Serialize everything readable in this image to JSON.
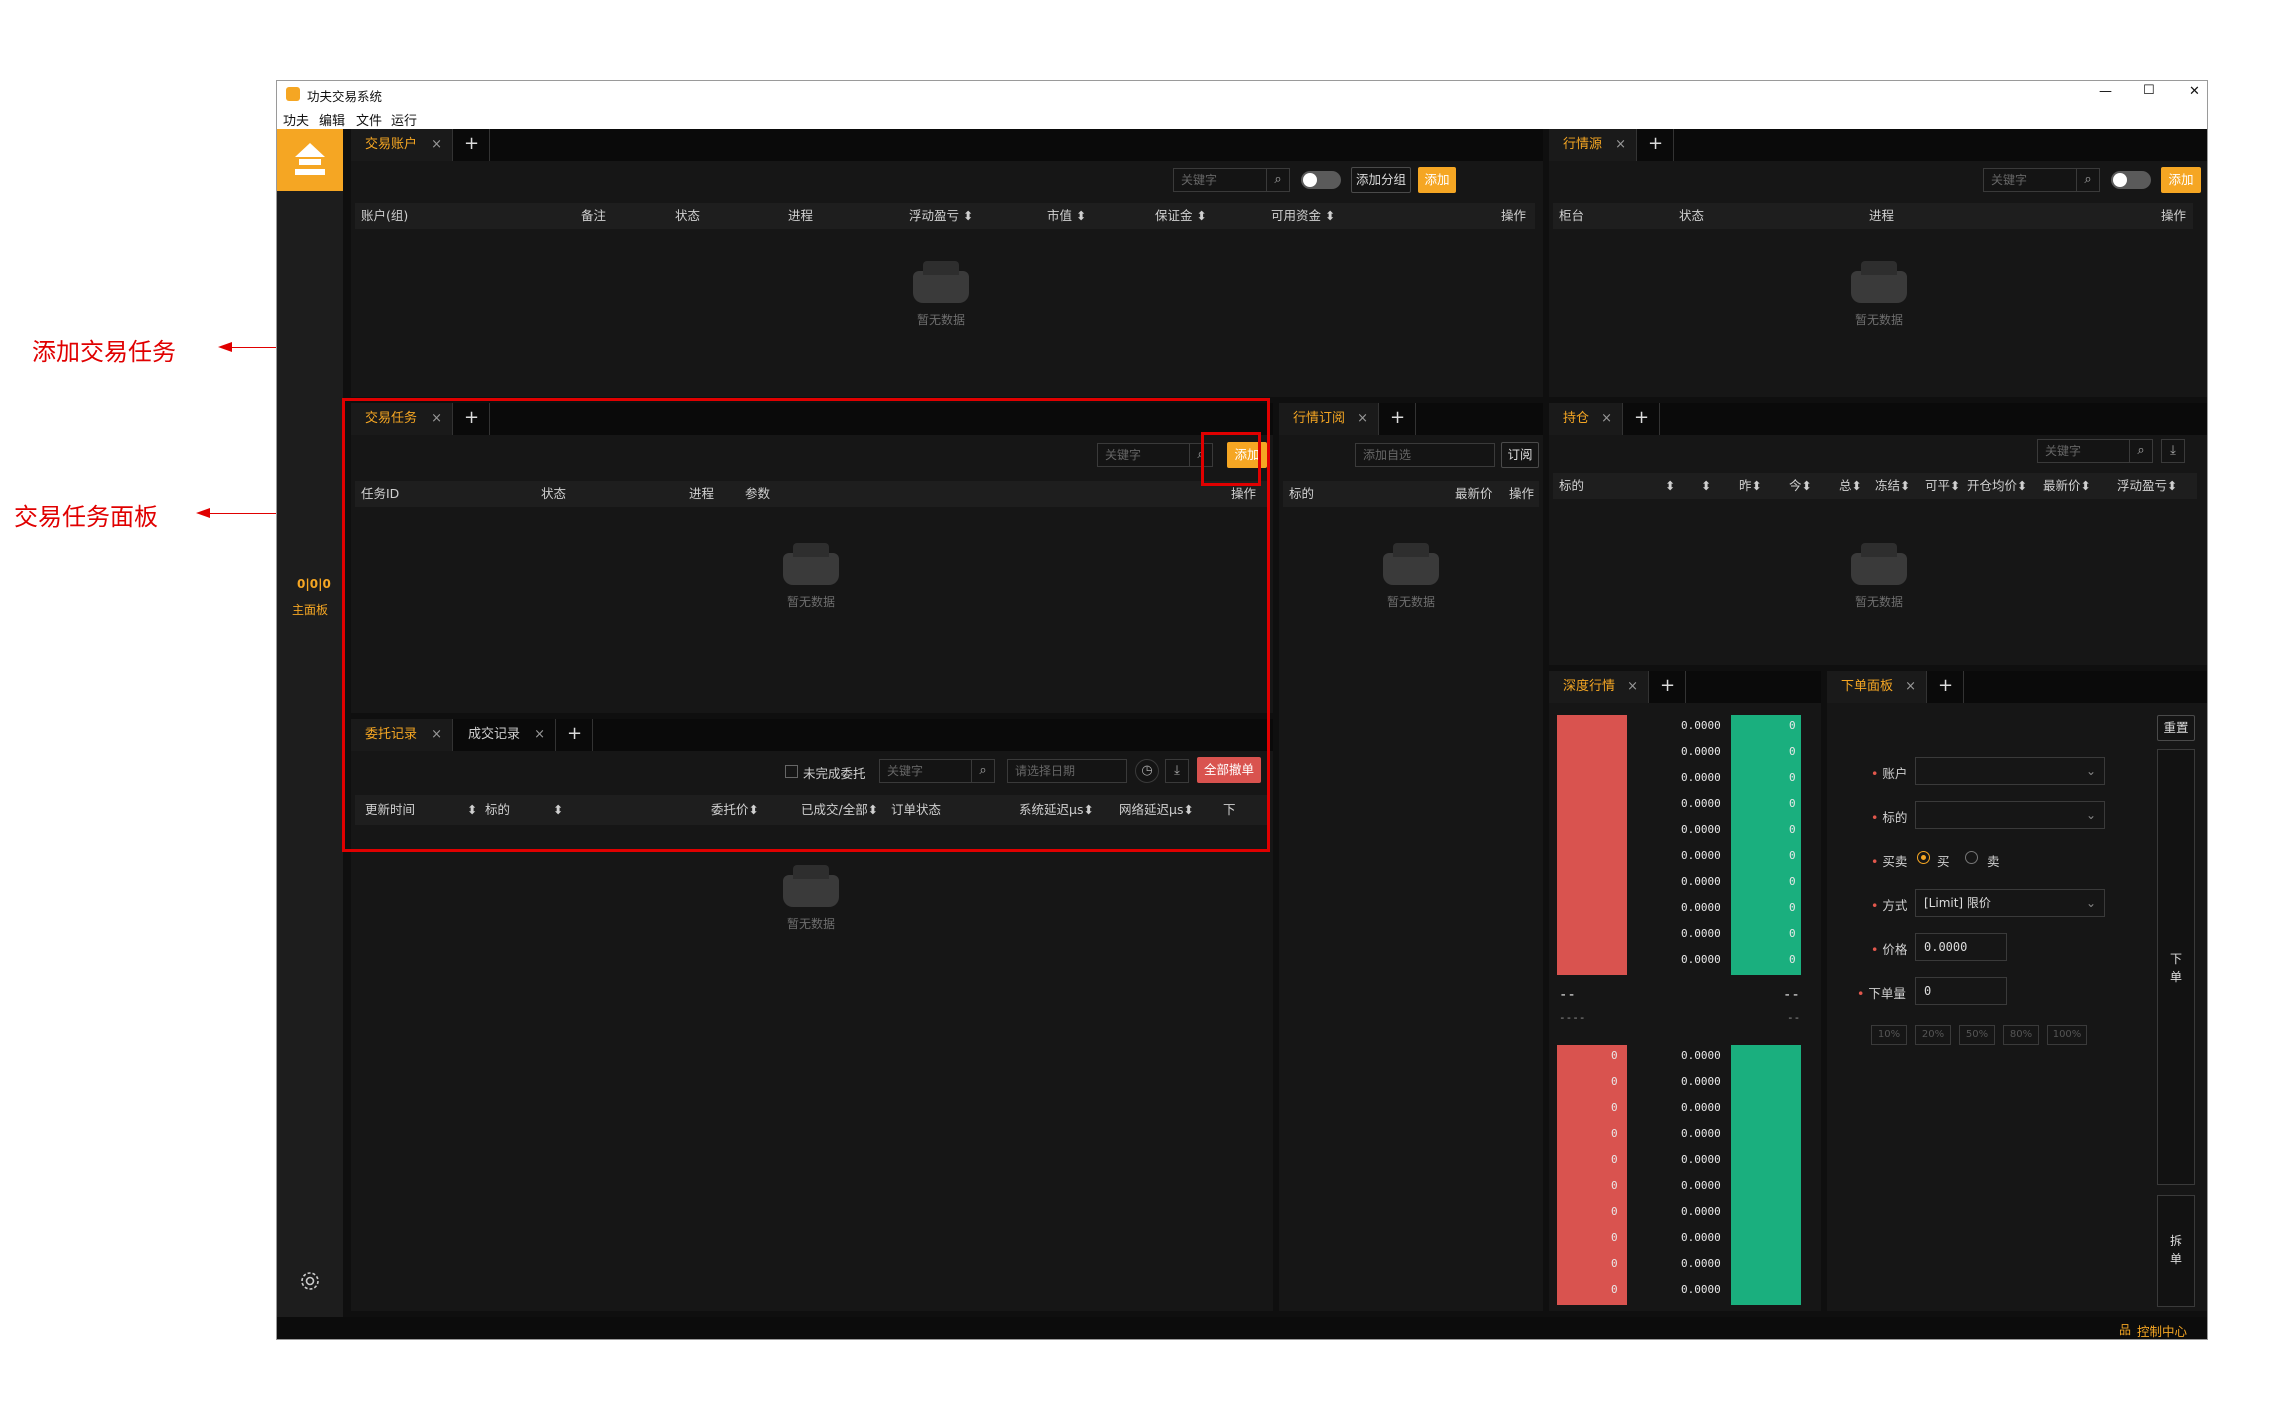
{
  "window": {
    "title": "功夫交易系统",
    "min": "—",
    "max": "☐",
    "close": "✕"
  },
  "menu": [
    "功夫",
    "编辑",
    "文件",
    "运行"
  ],
  "sidebar": {
    "main_label": "主面板",
    "main_icon": "0|0|0"
  },
  "status": {
    "control_center": "控制中心",
    "icon": "品"
  },
  "common": {
    "keyword_ph": "关键字",
    "empty": "暂无数据",
    "add": "添加",
    "close": "×",
    "plus": "+",
    "search": "⌕",
    "download": "⤓"
  },
  "accounts": {
    "tab": "交易账户",
    "add_group": "添加分组",
    "columns": [
      "账户(组)",
      "备注",
      "状态",
      "进程",
      "浮动盈亏 ⬍",
      "市值 ⬍",
      "保证金 ⬍",
      "可用资金 ⬍",
      "操作"
    ]
  },
  "md_source": {
    "tab": "行情源",
    "columns": [
      "柜台",
      "状态",
      "进程",
      "操作"
    ]
  },
  "tasks": {
    "tab": "交易任务",
    "columns": [
      "任务ID",
      "状态",
      "进程",
      "参数",
      "操作"
    ]
  },
  "md_sub": {
    "tab": "行情订阅",
    "add_watch_ph": "添加自选",
    "subscribe": "订阅",
    "columns": [
      "标的",
      "最新价",
      "操作"
    ]
  },
  "positions": {
    "tab": "持仓",
    "columns": [
      "标的",
      "⬍",
      "⬍",
      "昨⬍",
      "今⬍",
      "总⬍",
      "冻结⬍",
      "可平⬍",
      "开仓均价⬍",
      "最新价⬍",
      "浮动盈亏⬍"
    ]
  },
  "orders": {
    "tab": "委托记录",
    "tab2": "成交记录",
    "unfinished": "未完成委托",
    "date_ph": "请选择日期",
    "cancel_all": "全部撤单",
    "columns": [
      "更新时间",
      "⬍",
      "标的",
      "⬍",
      "委托价⬍",
      "已成交/全部⬍",
      "订单状态",
      "系统延迟μs⬍",
      "网络延迟μs⬍",
      "下"
    ]
  },
  "depth": {
    "tab": "深度行情",
    "ask_prices": [
      "0.0000",
      "0.0000",
      "0.0000",
      "0.0000",
      "0.0000",
      "0.0000",
      "0.0000",
      "0.0000",
      "0.0000",
      "0.0000"
    ],
    "ask_vols": [
      "0",
      "0",
      "0",
      "0",
      "0",
      "0",
      "0",
      "0",
      "0",
      "0"
    ],
    "bid_prices": [
      "0.0000",
      "0.0000",
      "0.0000",
      "0.0000",
      "0.0000",
      "0.0000",
      "0.0000",
      "0.0000",
      "0.0000",
      "0.0000"
    ],
    "bid_vols": [
      "0",
      "0",
      "0",
      "0",
      "0",
      "0",
      "0",
      "0",
      "0",
      "0"
    ],
    "mid_left": "--",
    "mid_right": "--",
    "mid_left2": "----",
    "mid_right2": "--"
  },
  "order_panel": {
    "tab": "下单面板",
    "reset": "重置",
    "account": "账户",
    "instrument": "标的",
    "side": "买卖",
    "buy": "买",
    "sell": "卖",
    "method": "方式",
    "method_val": "[Limit] 限价",
    "price": "价格",
    "price_val": "0.0000",
    "volume": "下单量",
    "volume_val": "0",
    "pcts": [
      "10%",
      "20%",
      "50%",
      "80%",
      "100%"
    ],
    "place": "下 单",
    "split": "拆 单"
  },
  "annotations": {
    "add_task": "添加交易任务",
    "task_panel": "交易任务面板"
  },
  "colors": {
    "accent": "#f5a623",
    "ask": "#d9534f",
    "bid": "#1aaf7e",
    "annotation": "#e00000"
  }
}
